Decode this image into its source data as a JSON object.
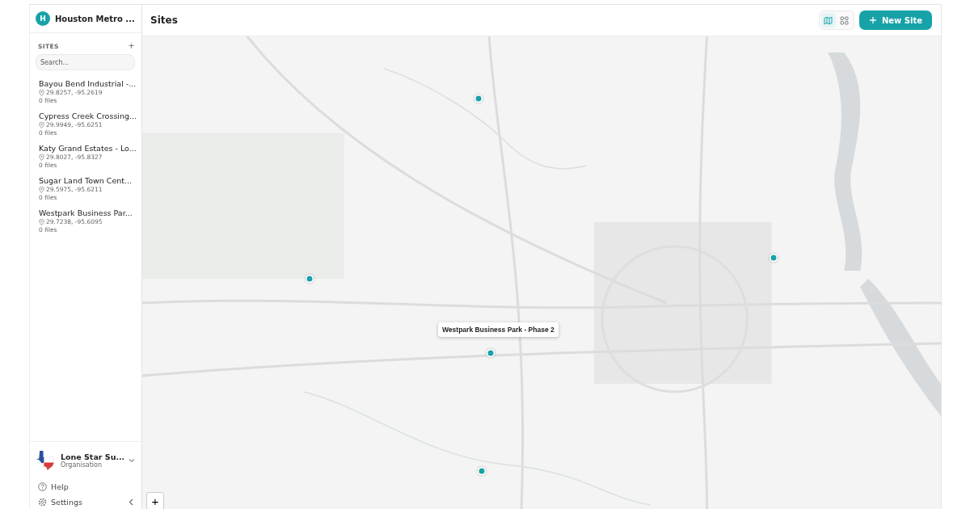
{
  "workspace": {
    "initial": "H",
    "name": "Houston Metro ..."
  },
  "sites": {
    "heading": "SITES",
    "add": "+",
    "search": {
      "placeholder": "Search..."
    },
    "items": [
      {
        "name": "Bayou Bend Industrial -...",
        "coords": "29.8257, -95.2619",
        "files": "0 files"
      },
      {
        "name": "Cypress Creek Crossing...",
        "coords": "29.9949, -95.6251",
        "files": "0 files"
      },
      {
        "name": "Katy Grand Estates - Lo...",
        "coords": "29.8027, -95.8327",
        "files": "0 files"
      },
      {
        "name": "Sugar Land Town Cent...",
        "coords": "29.5975, -95.6211",
        "files": "0 files"
      },
      {
        "name": "Westpark Business Par...",
        "coords": "29.7238, -95.6095",
        "files": "0 files"
      }
    ]
  },
  "organisation": {
    "name": "Lone Star Su...",
    "role": "Organisation"
  },
  "footer": [
    {
      "kind": "help",
      "label": "Help"
    },
    {
      "kind": "settings",
      "label": "Settings"
    }
  ],
  "header": {
    "title": "Sites",
    "views": [
      {
        "kind": "map",
        "selected": true
      },
      {
        "kind": "grid",
        "selected": false
      }
    ],
    "new_button": "New Site"
  },
  "map": {
    "kind": "picture",
    "tooltip": "Westpark Business Park - Phase 2",
    "zoom_in": "+"
  }
}
